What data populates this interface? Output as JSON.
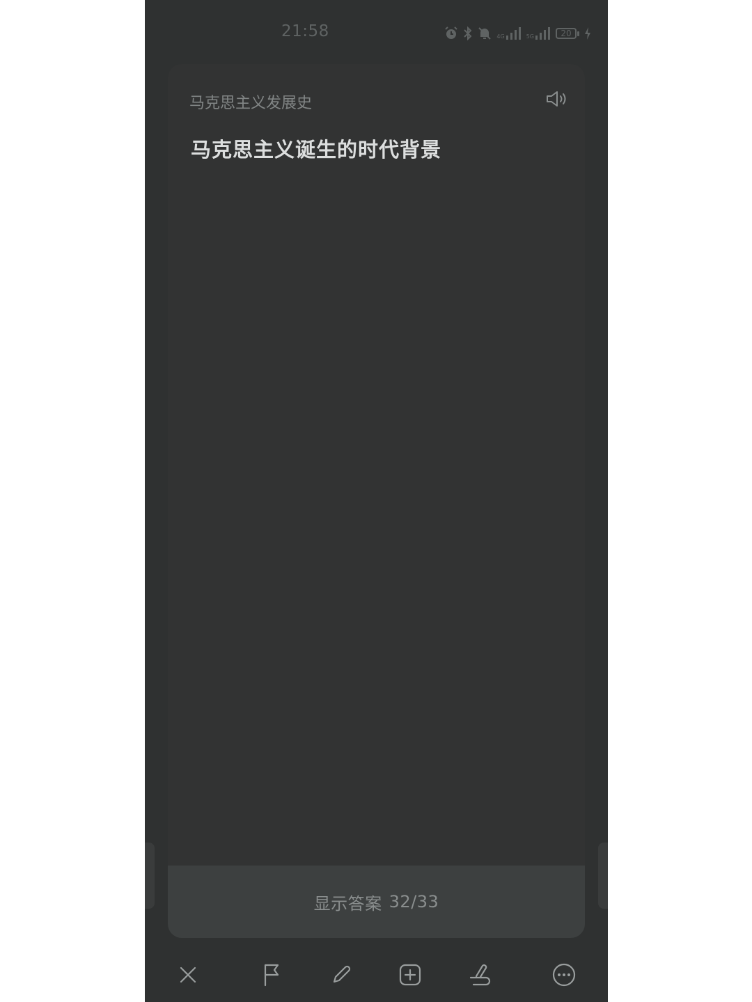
{
  "status_bar": {
    "time": "21:58",
    "network_1": "4G",
    "network_2": "5G",
    "battery": "20"
  },
  "card": {
    "deck_name": "马克思主义发展史",
    "question": "马克思主义诞生的时代背景"
  },
  "show_answer": {
    "label": "显示答案",
    "progress": "32/33"
  },
  "toolbar": {
    "items": [
      "close-icon",
      "flag-icon",
      "edit-icon",
      "add-icon",
      "undo-icon",
      "more-icon"
    ]
  },
  "colors": {
    "background": "#2f3131",
    "card": "#323333",
    "button": "#3d4040",
    "icon": "#9a9e9e"
  }
}
